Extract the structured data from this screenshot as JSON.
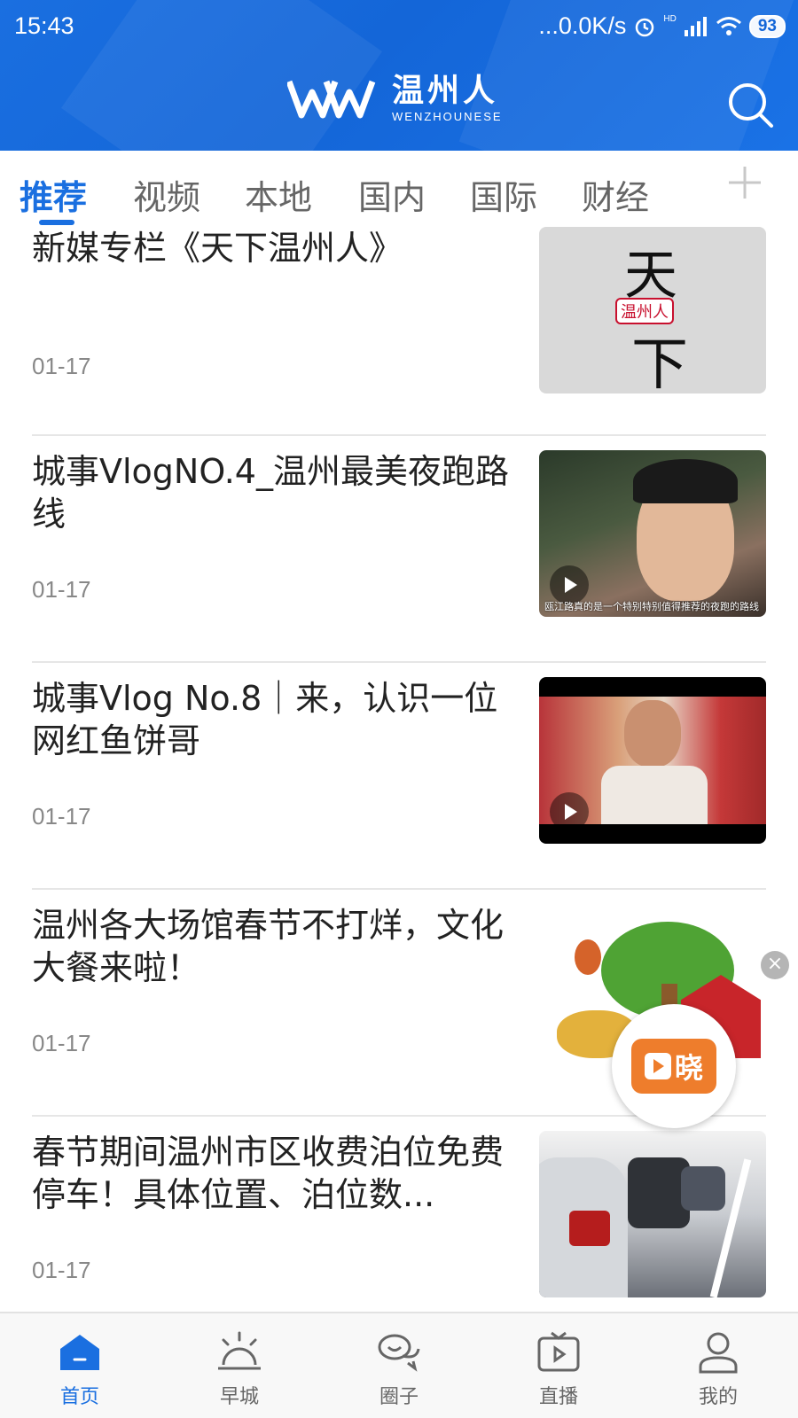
{
  "status_bar": {
    "time": "15:43",
    "network_speed": "...0.0K/s",
    "signal_label": "HD",
    "battery": "93"
  },
  "header": {
    "logo_cn": "温州人",
    "logo_en": "WENZHOUNESE",
    "search_icon": "search-icon"
  },
  "tabs": [
    {
      "label": "推荐",
      "active": true
    },
    {
      "label": "视频",
      "active": false
    },
    {
      "label": "本地",
      "active": false
    },
    {
      "label": "国内",
      "active": false
    },
    {
      "label": "国际",
      "active": false
    },
    {
      "label": "财经",
      "active": false
    }
  ],
  "articles": [
    {
      "title": "新媒专栏《天下温州人》",
      "date": "01-17",
      "is_video": false,
      "thumb_text": [
        "天",
        "温州人",
        "下"
      ]
    },
    {
      "title": "城事VlogNO.4_温州最美夜跑路线",
      "date": "01-17",
      "is_video": true,
      "thumb_caption": "瓯江路真的是一个特别特别值得推荐的夜跑的路线"
    },
    {
      "title": "城事Vlog No.8｜来，认识一位网红鱼饼哥",
      "date": "01-17",
      "is_video": true
    },
    {
      "title": "温州各大场馆春节不打烊，文化大餐来啦！",
      "date": "01-17",
      "is_video": false
    },
    {
      "title": "春节期间温州市区收费泊位免费停车！具体位置、泊位数...",
      "date": "01-17",
      "is_video": false
    }
  ],
  "float_ad": {
    "label": "晓"
  },
  "bottom_nav": [
    {
      "label": "首页",
      "icon": "home-icon",
      "active": true
    },
    {
      "label": "早城",
      "icon": "sunrise-icon",
      "active": false
    },
    {
      "label": "圈子",
      "icon": "chat-icon",
      "active": false
    },
    {
      "label": "直播",
      "icon": "live-tv-icon",
      "active": false
    },
    {
      "label": "我的",
      "icon": "profile-icon",
      "active": false
    }
  ],
  "colors": {
    "brand_blue": "#1a6fe0",
    "date_gray": "#888888"
  }
}
